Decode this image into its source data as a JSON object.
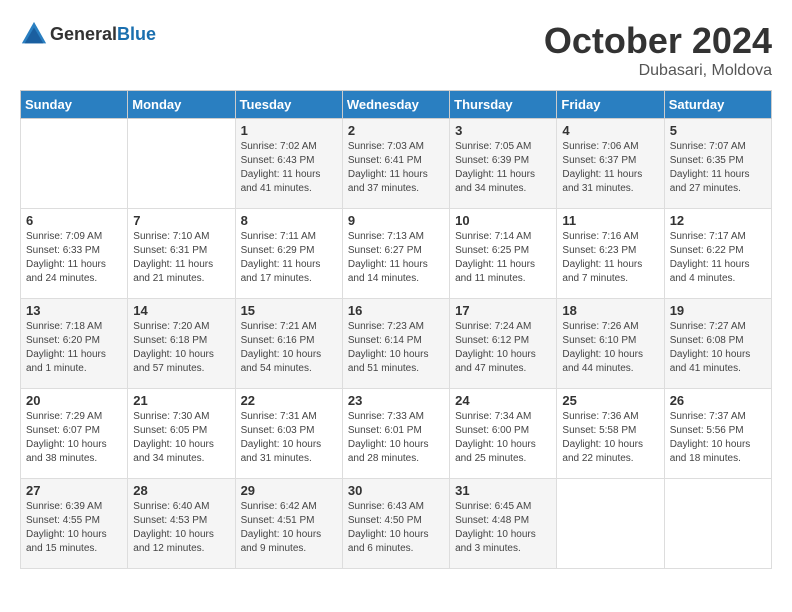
{
  "header": {
    "logo_general": "General",
    "logo_blue": "Blue",
    "month": "October 2024",
    "location": "Dubasari, Moldova"
  },
  "weekdays": [
    "Sunday",
    "Monday",
    "Tuesday",
    "Wednesday",
    "Thursday",
    "Friday",
    "Saturday"
  ],
  "weeks": [
    [
      {
        "day": "",
        "sunrise": "",
        "sunset": "",
        "daylight": ""
      },
      {
        "day": "",
        "sunrise": "",
        "sunset": "",
        "daylight": ""
      },
      {
        "day": "1",
        "sunrise": "Sunrise: 7:02 AM",
        "sunset": "Sunset: 6:43 PM",
        "daylight": "Daylight: 11 hours and 41 minutes."
      },
      {
        "day": "2",
        "sunrise": "Sunrise: 7:03 AM",
        "sunset": "Sunset: 6:41 PM",
        "daylight": "Daylight: 11 hours and 37 minutes."
      },
      {
        "day": "3",
        "sunrise": "Sunrise: 7:05 AM",
        "sunset": "Sunset: 6:39 PM",
        "daylight": "Daylight: 11 hours and 34 minutes."
      },
      {
        "day": "4",
        "sunrise": "Sunrise: 7:06 AM",
        "sunset": "Sunset: 6:37 PM",
        "daylight": "Daylight: 11 hours and 31 minutes."
      },
      {
        "day": "5",
        "sunrise": "Sunrise: 7:07 AM",
        "sunset": "Sunset: 6:35 PM",
        "daylight": "Daylight: 11 hours and 27 minutes."
      }
    ],
    [
      {
        "day": "6",
        "sunrise": "Sunrise: 7:09 AM",
        "sunset": "Sunset: 6:33 PM",
        "daylight": "Daylight: 11 hours and 24 minutes."
      },
      {
        "day": "7",
        "sunrise": "Sunrise: 7:10 AM",
        "sunset": "Sunset: 6:31 PM",
        "daylight": "Daylight: 11 hours and 21 minutes."
      },
      {
        "day": "8",
        "sunrise": "Sunrise: 7:11 AM",
        "sunset": "Sunset: 6:29 PM",
        "daylight": "Daylight: 11 hours and 17 minutes."
      },
      {
        "day": "9",
        "sunrise": "Sunrise: 7:13 AM",
        "sunset": "Sunset: 6:27 PM",
        "daylight": "Daylight: 11 hours and 14 minutes."
      },
      {
        "day": "10",
        "sunrise": "Sunrise: 7:14 AM",
        "sunset": "Sunset: 6:25 PM",
        "daylight": "Daylight: 11 hours and 11 minutes."
      },
      {
        "day": "11",
        "sunrise": "Sunrise: 7:16 AM",
        "sunset": "Sunset: 6:23 PM",
        "daylight": "Daylight: 11 hours and 7 minutes."
      },
      {
        "day": "12",
        "sunrise": "Sunrise: 7:17 AM",
        "sunset": "Sunset: 6:22 PM",
        "daylight": "Daylight: 11 hours and 4 minutes."
      }
    ],
    [
      {
        "day": "13",
        "sunrise": "Sunrise: 7:18 AM",
        "sunset": "Sunset: 6:20 PM",
        "daylight": "Daylight: 11 hours and 1 minute."
      },
      {
        "day": "14",
        "sunrise": "Sunrise: 7:20 AM",
        "sunset": "Sunset: 6:18 PM",
        "daylight": "Daylight: 10 hours and 57 minutes."
      },
      {
        "day": "15",
        "sunrise": "Sunrise: 7:21 AM",
        "sunset": "Sunset: 6:16 PM",
        "daylight": "Daylight: 10 hours and 54 minutes."
      },
      {
        "day": "16",
        "sunrise": "Sunrise: 7:23 AM",
        "sunset": "Sunset: 6:14 PM",
        "daylight": "Daylight: 10 hours and 51 minutes."
      },
      {
        "day": "17",
        "sunrise": "Sunrise: 7:24 AM",
        "sunset": "Sunset: 6:12 PM",
        "daylight": "Daylight: 10 hours and 47 minutes."
      },
      {
        "day": "18",
        "sunrise": "Sunrise: 7:26 AM",
        "sunset": "Sunset: 6:10 PM",
        "daylight": "Daylight: 10 hours and 44 minutes."
      },
      {
        "day": "19",
        "sunrise": "Sunrise: 7:27 AM",
        "sunset": "Sunset: 6:08 PM",
        "daylight": "Daylight: 10 hours and 41 minutes."
      }
    ],
    [
      {
        "day": "20",
        "sunrise": "Sunrise: 7:29 AM",
        "sunset": "Sunset: 6:07 PM",
        "daylight": "Daylight: 10 hours and 38 minutes."
      },
      {
        "day": "21",
        "sunrise": "Sunrise: 7:30 AM",
        "sunset": "Sunset: 6:05 PM",
        "daylight": "Daylight: 10 hours and 34 minutes."
      },
      {
        "day": "22",
        "sunrise": "Sunrise: 7:31 AM",
        "sunset": "Sunset: 6:03 PM",
        "daylight": "Daylight: 10 hours and 31 minutes."
      },
      {
        "day": "23",
        "sunrise": "Sunrise: 7:33 AM",
        "sunset": "Sunset: 6:01 PM",
        "daylight": "Daylight: 10 hours and 28 minutes."
      },
      {
        "day": "24",
        "sunrise": "Sunrise: 7:34 AM",
        "sunset": "Sunset: 6:00 PM",
        "daylight": "Daylight: 10 hours and 25 minutes."
      },
      {
        "day": "25",
        "sunrise": "Sunrise: 7:36 AM",
        "sunset": "Sunset: 5:58 PM",
        "daylight": "Daylight: 10 hours and 22 minutes."
      },
      {
        "day": "26",
        "sunrise": "Sunrise: 7:37 AM",
        "sunset": "Sunset: 5:56 PM",
        "daylight": "Daylight: 10 hours and 18 minutes."
      }
    ],
    [
      {
        "day": "27",
        "sunrise": "Sunrise: 6:39 AM",
        "sunset": "Sunset: 4:55 PM",
        "daylight": "Daylight: 10 hours and 15 minutes."
      },
      {
        "day": "28",
        "sunrise": "Sunrise: 6:40 AM",
        "sunset": "Sunset: 4:53 PM",
        "daylight": "Daylight: 10 hours and 12 minutes."
      },
      {
        "day": "29",
        "sunrise": "Sunrise: 6:42 AM",
        "sunset": "Sunset: 4:51 PM",
        "daylight": "Daylight: 10 hours and 9 minutes."
      },
      {
        "day": "30",
        "sunrise": "Sunrise: 6:43 AM",
        "sunset": "Sunset: 4:50 PM",
        "daylight": "Daylight: 10 hours and 6 minutes."
      },
      {
        "day": "31",
        "sunrise": "Sunrise: 6:45 AM",
        "sunset": "Sunset: 4:48 PM",
        "daylight": "Daylight: 10 hours and 3 minutes."
      },
      {
        "day": "",
        "sunrise": "",
        "sunset": "",
        "daylight": ""
      },
      {
        "day": "",
        "sunrise": "",
        "sunset": "",
        "daylight": ""
      }
    ]
  ]
}
